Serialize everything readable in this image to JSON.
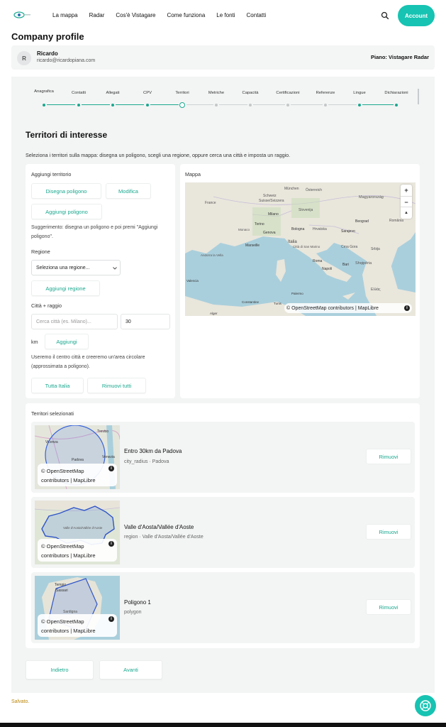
{
  "nav": {
    "items": [
      "La mappa",
      "Radar",
      "Cos'è Vistagare",
      "Come funziona",
      "Le fonti",
      "Contatti"
    ],
    "account_label": "Account"
  },
  "page": {
    "title": "Company profile"
  },
  "user": {
    "initial": "R",
    "name": "Ricardo",
    "email": "ricardo@ricardopiana.com",
    "plan": "Piano: Vistagare Radar"
  },
  "steps": {
    "labels": [
      "Anagrafica",
      "Contatti",
      "Allegati",
      "CPV",
      "Territori",
      "Metriche",
      "Capacità",
      "Certificazioni",
      "Referenze",
      "Lingue",
      "Dichiarazioni"
    ],
    "current": 4
  },
  "territori": {
    "title": "Territori di interesse",
    "description": "Seleziona i territori sulla mappa: disegna un poligono, scegli una regione, oppure cerca una città e imposta un raggio.",
    "add": {
      "heading": "Aggiungi territorio",
      "draw_polygon": "Disegna poligono",
      "edit": "Modifica",
      "add_polygon": "Aggiungi poligono",
      "hint": "Suggerimento: disegna un poligono e poi premi \"Aggiungi poligono\".",
      "region_label": "Regione",
      "region_select": "Seleziona una regione...",
      "add_region": "Aggiungi regione",
      "city_label": "Città + raggio",
      "city_placeholder": "Cerca città (es. Milano)...",
      "radius_value": "30",
      "km": "km",
      "add_city": "Aggiungi",
      "city_hint": "Useremo il centro città e creeremo un'area circolare (approssimata a poligono).",
      "all_italy": "Tutta Italia",
      "remove_all": "Rimuovi tutti"
    },
    "map": {
      "heading": "Mappa",
      "attribution": "© OpenStreetMap contributors | MapLibre",
      "zoom_in": "+",
      "zoom_out": "−",
      "compass": "▲",
      "places": [
        "München",
        "Österreich",
        "Magyarország",
        "Schweiz",
        "Suisse/Svizzera",
        "France",
        "Slovenija",
        "Milano",
        "Torino",
        "Genova",
        "Bologna",
        "Hrvatska",
        "Sarajevo",
        "Beograd",
        "România",
        "Monaco",
        "Italia",
        "Città di San Marino",
        "Roma",
        "Crna Gora",
        "Srbija",
        "Marseille",
        "Andorra la Vella",
        "Napoli",
        "Bari",
        "Shqipëria",
        "Valencia",
        "Tunis",
        "Palermo",
        "Ελλάς",
        "Constantine",
        "Alger"
      ]
    },
    "selected": {
      "heading": "Territori selezionati",
      "thumb_attr_line1": "© OpenStreetMap",
      "thumb_attr_line2": "contributors | MapLibre",
      "remove_label": "Rimuovi",
      "items": [
        {
          "title": "Entro 30km da Padova",
          "sub": "city_radius · Padova",
          "thumb_places": [
            "Vicenza",
            "Treviso",
            "Padova",
            "Venezia"
          ]
        },
        {
          "title": "Valle d'Aosta/Vallée d'Aoste",
          "sub": "region · Valle d'Aosta/Vallée d'Aoste",
          "thumb_places": [
            "Valle d'Aosta/Vallée d'Aoste"
          ]
        },
        {
          "title": "Poligono 1",
          "sub": "polygon",
          "thumb_places": [
            "Tempio",
            "Sassari",
            "Sardigna"
          ]
        }
      ]
    }
  },
  "actions": {
    "back": "Indietro",
    "next": "Avanti"
  },
  "status": {
    "saved": "Salvato."
  },
  "colors": {
    "accent": "#17c3b2",
    "accent_text": "#1aa88f",
    "panel_bg": "#f3f4f4",
    "sea": "#aacfdc",
    "land": "#e9e6dc"
  },
  "icons": {
    "search": "search-icon",
    "help": "lifebuoy-icon",
    "info": "info-icon"
  }
}
